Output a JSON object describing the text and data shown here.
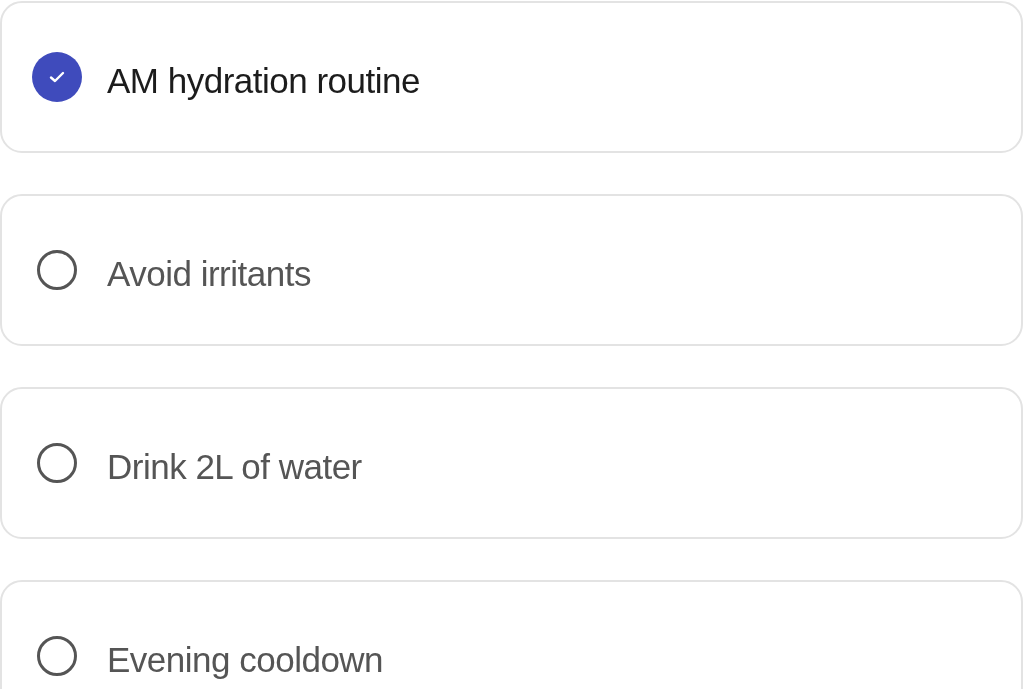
{
  "tasks": [
    {
      "label": "AM hydration routine",
      "checked": true
    },
    {
      "label": "Avoid irritants",
      "checked": false
    },
    {
      "label": "Drink 2L of water",
      "checked": false
    },
    {
      "label": "Evening cooldown",
      "checked": false
    }
  ]
}
